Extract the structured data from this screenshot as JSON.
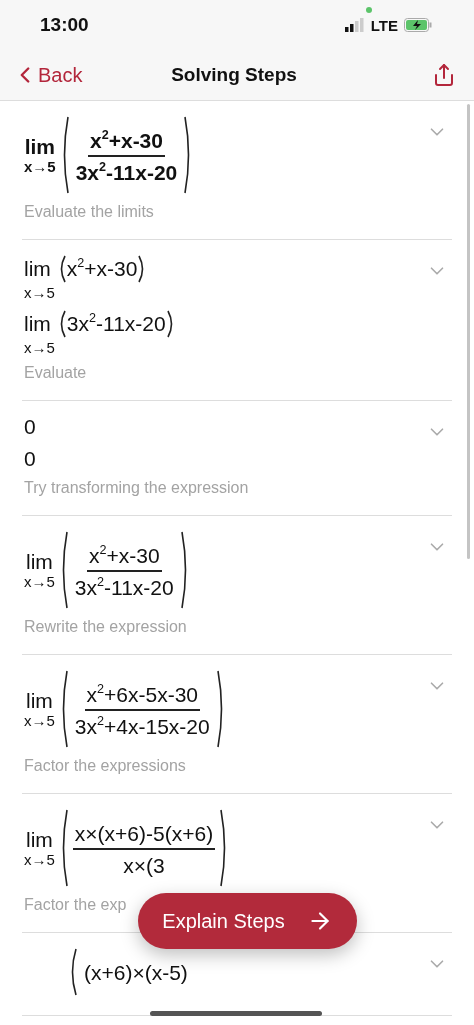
{
  "status_bar": {
    "time": "13:00",
    "network": "LTE"
  },
  "nav": {
    "back": "Back",
    "title": "Solving Steps"
  },
  "steps": [
    {
      "bold": true,
      "expressions": [
        {
          "kind": "limit_fraction",
          "lim": "lim",
          "under": "x→5",
          "numerator": "x$^{2}$+x-30",
          "denominator": "3x$^{2}$-11x-20"
        }
      ],
      "hint": "Evaluate the limits"
    },
    {
      "bold": false,
      "expressions": [
        {
          "kind": "limit",
          "lim": "lim",
          "under": "x→5",
          "body": "x$^{2}$+x-30"
        },
        {
          "kind": "limit",
          "lim": "lim",
          "under": "x→5",
          "body": "3x$^{2}$-11x-20"
        }
      ],
      "hint": "Evaluate"
    },
    {
      "bold": false,
      "expressions": [
        {
          "kind": "plain",
          "text": "0"
        },
        {
          "kind": "plain",
          "text": "0"
        }
      ],
      "hint": "Try transforming the expression"
    },
    {
      "bold": false,
      "expressions": [
        {
          "kind": "limit_fraction",
          "lim": "lim",
          "under": "x→5",
          "numerator": "x$^{2}$+x-30",
          "denominator": "3x$^{2}$-11x-20"
        }
      ],
      "hint": "Rewrite the expression"
    },
    {
      "bold": false,
      "expressions": [
        {
          "kind": "limit_fraction",
          "lim": "lim",
          "under": "x→5",
          "numerator": "x$^{2}$+6x-5x-30",
          "denominator": "3x$^{2}$+4x-15x-20"
        }
      ],
      "hint": "Factor the expressions"
    },
    {
      "bold": false,
      "expressions": [
        {
          "kind": "limit_fraction",
          "lim": "lim",
          "under": "x→5",
          "numerator": "x×(x+6)-5(x+6)",
          "denominator": "x×(3"
        }
      ],
      "hint": "Factor the exp"
    },
    {
      "bold": false,
      "expressions": [
        {
          "kind": "numerator_only",
          "numerator": "(x+6)×(x-5)"
        }
      ]
    }
  ],
  "explain_button": {
    "label": "Explain Steps"
  }
}
